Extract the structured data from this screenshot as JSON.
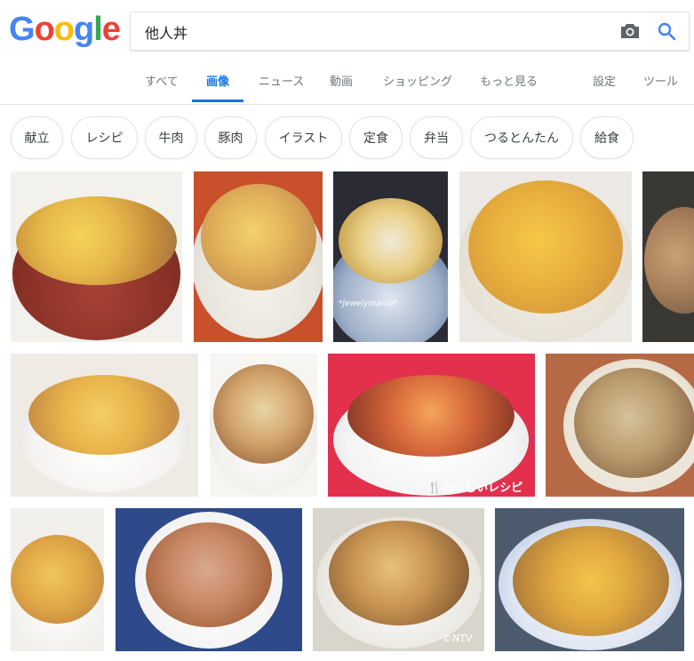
{
  "logo": {
    "letters": [
      "G",
      "o",
      "o",
      "g",
      "l",
      "e"
    ],
    "colors": [
      "#4285f4",
      "#ea4335",
      "#fbbc05",
      "#4285f4",
      "#34a853",
      "#ea4335"
    ]
  },
  "search": {
    "query": "他人丼"
  },
  "tabs": [
    "すべて",
    "画像",
    "ニュース",
    "動画",
    "ショッピング",
    "もっと見る",
    "設定",
    "ツール"
  ],
  "chips": [
    "献立",
    "レシピ",
    "牛肉",
    "豚肉",
    "イラスト",
    "定食",
    "弁当",
    "つるとんたん",
    "給食"
  ],
  "watermarks": {
    "jewely": "*Jewelymama*",
    "oishii": "🍴おいしいレシピ",
    "ntv": "©NTV"
  },
  "colors": {
    "accent": "#1a73e8",
    "tab_text": "#70757a",
    "chip_border": "#dfe1e5"
  }
}
